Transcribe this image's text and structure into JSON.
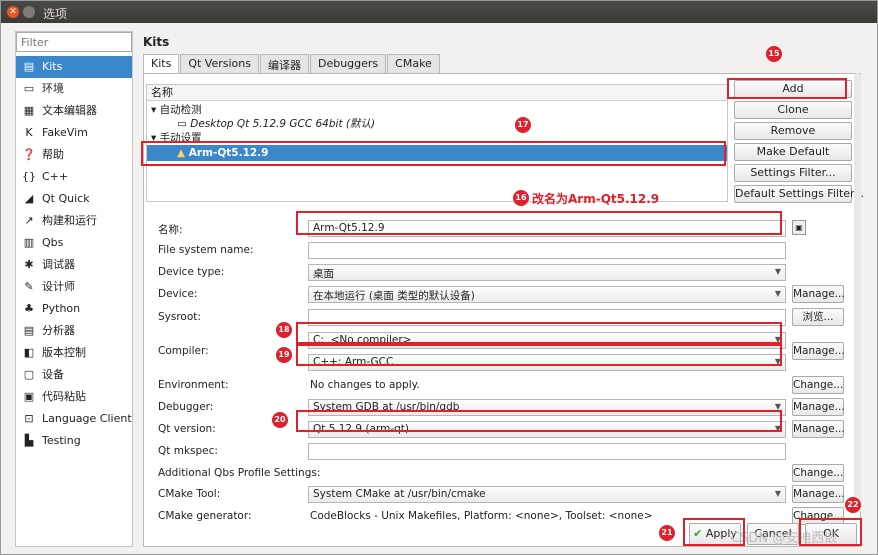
{
  "window": {
    "title": "选项"
  },
  "sidebar": {
    "filter_placeholder": "Filter",
    "items": [
      {
        "icon": "monitor-icon",
        "glyph": "▤",
        "label": "Kits"
      },
      {
        "icon": "environment-icon",
        "glyph": "▭",
        "label": "环境"
      },
      {
        "icon": "text-editor-icon",
        "glyph": "▦",
        "label": "文本编辑器"
      },
      {
        "icon": "fakevim-icon",
        "glyph": "K",
        "label": "FakeVim"
      },
      {
        "icon": "help-icon",
        "glyph": "❓",
        "label": "帮助"
      },
      {
        "icon": "cpp-icon",
        "glyph": "{}",
        "label": "C++"
      },
      {
        "icon": "qtquick-icon",
        "glyph": "◢",
        "label": "Qt Quick"
      },
      {
        "icon": "build-run-icon",
        "glyph": "↗",
        "label": "构建和运行"
      },
      {
        "icon": "qbs-icon",
        "glyph": "▥",
        "label": "Qbs"
      },
      {
        "icon": "debugger-icon",
        "glyph": "✱",
        "label": "调试器"
      },
      {
        "icon": "designer-icon",
        "glyph": "✎",
        "label": "设计师"
      },
      {
        "icon": "python-icon",
        "glyph": "♣",
        "label": "Python"
      },
      {
        "icon": "analyzer-icon",
        "glyph": "▤",
        "label": "分析器"
      },
      {
        "icon": "version-control-icon",
        "glyph": "◧",
        "label": "版本控制"
      },
      {
        "icon": "devices-icon",
        "glyph": "▢",
        "label": "设备"
      },
      {
        "icon": "code-paste-icon",
        "glyph": "▣",
        "label": "代码粘贴"
      },
      {
        "icon": "language-client-icon",
        "glyph": "⊡",
        "label": "Language Client"
      },
      {
        "icon": "testing-icon",
        "glyph": "▙",
        "label": "Testing"
      }
    ]
  },
  "main": {
    "heading": "Kits",
    "tabs": [
      "Kits",
      "Qt Versions",
      "编译器",
      "Debuggers",
      "CMake"
    ],
    "tree": {
      "header": "名称",
      "group_auto": "自动检测",
      "auto_kit": "Desktop Qt 5.12.9 GCC 64bit (默认)",
      "group_manual": "手动设置",
      "manual_kit": "Arm-Qt5.12.9"
    },
    "buttons": [
      "Add",
      "Clone",
      "Remove",
      "Make Default",
      "Settings Filter...",
      "Default Settings Filter..."
    ],
    "annotation_rename": "改名为Arm-Qt5.12.9"
  },
  "form": {
    "name_label": "名称:",
    "name_value": "Arm-Qt5.12.9",
    "fs_label": "File system name:",
    "fs_value": "",
    "device_type_label": "Device type:",
    "device_type_value": "桌面",
    "device_label": "Device:",
    "device_value": "在本地运行 (桌面 类型的默认设备)",
    "sysroot_label": "Sysroot:",
    "sysroot_value": "",
    "browse": "浏览...",
    "compiler_label": "Compiler:",
    "compiler_c_prefix": "C:",
    "compiler_c_value": "<No compiler>",
    "compiler_cpp_prefix": "C++:",
    "compiler_cpp_value": "Arm-GCC",
    "environment_label": "Environment:",
    "environment_value": "No changes to apply.",
    "debugger_label": "Debugger:",
    "debugger_value": "System GDB at /usr/bin/gdb",
    "qtversion_label": "Qt version:",
    "qtversion_value": "Qt 5.12.9 (arm-qt)",
    "qtmkspec_label": "Qt mkspec:",
    "qtmkspec_value": "",
    "qbs_label": "Additional Qbs Profile Settings:",
    "cmake_tool_label": "CMake Tool:",
    "cmake_tool_value": "System CMake at /usr/bin/cmake",
    "cmake_gen_label": "CMake generator:",
    "cmake_gen_value": "CodeBlocks - Unix Makefiles, Platform: <none>, Toolset: <none>",
    "manage": "Manage...",
    "change": "Change..."
  },
  "dialog": {
    "apply": "Apply",
    "cancel": "Cancel",
    "ok": "OK"
  },
  "badges": [
    "15",
    "16",
    "17",
    "18",
    "19",
    "20",
    "21",
    "22"
  ],
  "watermark": "CSDN @安迪西嵌"
}
